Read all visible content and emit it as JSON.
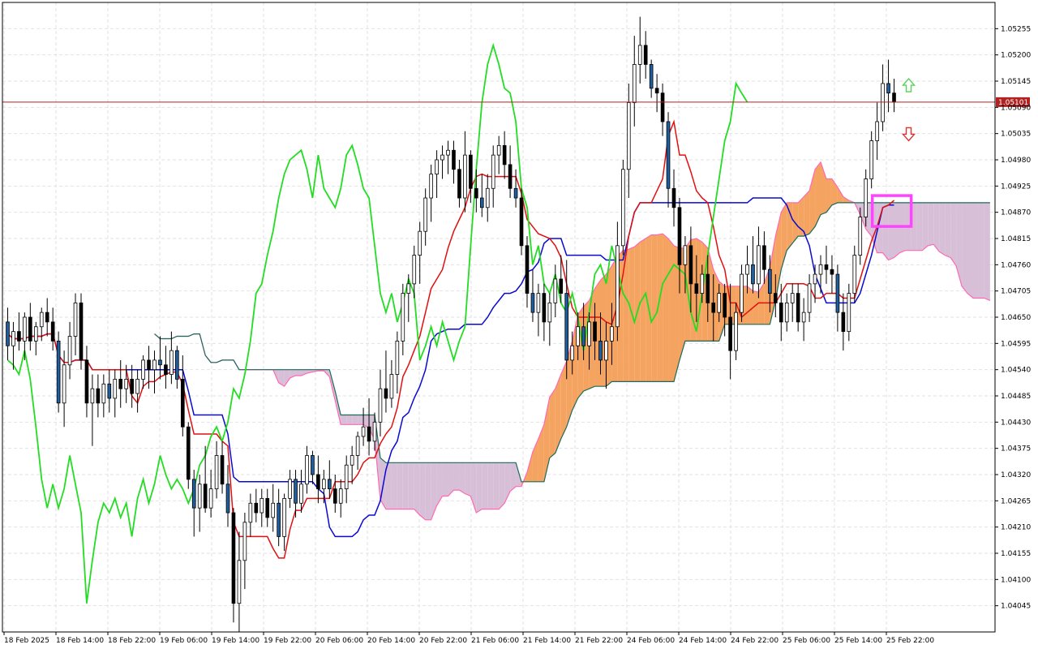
{
  "chart_data": {
    "type": "candlestick",
    "title": "",
    "y_axis": {
      "range": [
        1.0399,
        1.0531
      ],
      "ticks": [
        "1.05255",
        "1.05200",
        "1.05145",
        "1.05090",
        "1.05035",
        "1.04980",
        "1.04925",
        "1.04870",
        "1.04815",
        "1.04760",
        "1.04705",
        "1.04650",
        "1.04595",
        "1.04540",
        "1.04485",
        "1.04430",
        "1.04375",
        "1.04320",
        "1.04265",
        "1.04210",
        "1.04155",
        "1.04100",
        "1.04045"
      ]
    },
    "x_axis": {
      "ticks": [
        "18 Feb 2025",
        "18 Feb 14:00",
        "18 Feb 22:00",
        "19 Feb 06:00",
        "19 Feb 14:00",
        "19 Feb 22:00",
        "20 Feb 06:00",
        "20 Feb 14:00",
        "20 Feb 22:00",
        "21 Feb 06:00",
        "21 Feb 14:00",
        "21 Feb 22:00",
        "24 Feb 06:00",
        "24 Feb 14:00",
        "24 Feb 22:00",
        "25 Feb 06:00",
        "25 Feb 14:00",
        "25 Feb 22:00"
      ]
    },
    "current_price": "1.05101",
    "grid": true,
    "colors": {
      "bull_candle": "#ffffff",
      "bear_candle": "#000000",
      "alt_candle": "#1f5f9f",
      "tenkan": "#e01010",
      "kijun": "#0a0ad0",
      "chikou": "#22dd22",
      "cloud_bull": "#f4a460",
      "cloud_bear": "#d8bfd8",
      "span_line_teal": "#1a6b5a",
      "span_line_pink": "#ff69b4",
      "price_line": "#b22222",
      "highlight_box": "#ff44ff",
      "arrow_up": "#5ad05a",
      "arrow_down": "#e03030"
    },
    "candles": [
      [
        1.0464,
        1.0467,
        1.0456,
        1.0459
      ],
      [
        1.0459,
        1.0464,
        1.0454,
        1.0462
      ],
      [
        1.0462,
        1.0466,
        1.0458,
        1.046
      ],
      [
        1.046,
        1.0466,
        1.0456,
        1.0465
      ],
      [
        1.0465,
        1.0468,
        1.0458,
        1.046
      ],
      [
        1.046,
        1.0464,
        1.0457,
        1.0463
      ],
      [
        1.0463,
        1.0467,
        1.046,
        1.0466
      ],
      [
        1.0466,
        1.0469,
        1.0461,
        1.0464
      ],
      [
        1.0464,
        1.0467,
        1.0458,
        1.046
      ],
      [
        1.046,
        1.0462,
        1.0445,
        1.0447
      ],
      [
        1.0447,
        1.0458,
        1.0442,
        1.0455
      ],
      [
        1.0455,
        1.0464,
        1.0452,
        1.0461
      ],
      [
        1.0461,
        1.047,
        1.0457,
        1.0468
      ],
      [
        1.0468,
        1.047,
        1.0454,
        1.0456
      ],
      [
        1.0456,
        1.0459,
        1.0444,
        1.0447
      ],
      [
        1.0447,
        1.0453,
        1.0438,
        1.045
      ],
      [
        1.045,
        1.0453,
        1.0444,
        1.0447
      ],
      [
        1.0447,
        1.0453,
        1.0444,
        1.0451
      ],
      [
        1.0451,
        1.0454,
        1.0445,
        1.0448
      ],
      [
        1.0448,
        1.0454,
        1.0444,
        1.0452
      ],
      [
        1.0452,
        1.0456,
        1.0446,
        1.045
      ],
      [
        1.045,
        1.0455,
        1.0447,
        1.0452
      ],
      [
        1.0452,
        1.0455,
        1.0446,
        1.0449
      ],
      [
        1.0449,
        1.0454,
        1.0445,
        1.0452
      ],
      [
        1.0452,
        1.0457,
        1.045,
        1.0456
      ],
      [
        1.0456,
        1.0459,
        1.045,
        1.0454
      ],
      [
        1.0454,
        1.0458,
        1.0449,
        1.0456
      ],
      [
        1.0456,
        1.0461,
        1.0452,
        1.0455
      ],
      [
        1.0455,
        1.0459,
        1.045,
        1.0453
      ],
      [
        1.0453,
        1.0462,
        1.0451,
        1.0458
      ],
      [
        1.0458,
        1.0459,
        1.045,
        1.0452
      ],
      [
        1.0452,
        1.0457,
        1.044,
        1.0442
      ],
      [
        1.0442,
        1.0443,
        1.0429,
        1.0431
      ],
      [
        1.0431,
        1.0433,
        1.0419,
        1.0425
      ],
      [
        1.0425,
        1.0432,
        1.042,
        1.043
      ],
      [
        1.043,
        1.0438,
        1.0424,
        1.0425
      ],
      [
        1.0425,
        1.0433,
        1.0423,
        1.0429
      ],
      [
        1.0429,
        1.0439,
        1.0427,
        1.0436
      ],
      [
        1.0436,
        1.0439,
        1.0428,
        1.043
      ],
      [
        1.043,
        1.0434,
        1.0421,
        1.0424
      ],
      [
        1.0424,
        1.0425,
        1.0401,
        1.0405
      ],
      [
        1.0405,
        1.042,
        1.0399,
        1.0414
      ],
      [
        1.0414,
        1.0424,
        1.0408,
        1.0422
      ],
      [
        1.0422,
        1.0428,
        1.0419,
        1.0426
      ],
      [
        1.0426,
        1.0429,
        1.0422,
        1.0424
      ],
      [
        1.0424,
        1.0429,
        1.0421,
        1.0427
      ],
      [
        1.0427,
        1.0429,
        1.0421,
        1.0423
      ],
      [
        1.0423,
        1.043,
        1.042,
        1.0426
      ],
      [
        1.0426,
        1.0429,
        1.0417,
        1.0419
      ],
      [
        1.0419,
        1.0428,
        1.0416,
        1.0427
      ],
      [
        1.0427,
        1.0433,
        1.0425,
        1.0431
      ],
      [
        1.0431,
        1.0433,
        1.0423,
        1.0426
      ],
      [
        1.0426,
        1.0433,
        1.0424,
        1.043
      ],
      [
        1.043,
        1.0438,
        1.0428,
        1.0436
      ],
      [
        1.0436,
        1.0437,
        1.043,
        1.0432
      ],
      [
        1.0432,
        1.0436,
        1.0426,
        1.0429
      ],
      [
        1.0429,
        1.0433,
        1.0426,
        1.0431
      ],
      [
        1.0431,
        1.0435,
        1.0427,
        1.0429
      ],
      [
        1.0429,
        1.0432,
        1.0424,
        1.0426
      ],
      [
        1.0426,
        1.0431,
        1.0423,
        1.0429
      ],
      [
        1.0429,
        1.0436,
        1.0426,
        1.0434
      ],
      [
        1.0434,
        1.0438,
        1.043,
        1.0436
      ],
      [
        1.0436,
        1.0441,
        1.0433,
        1.044
      ],
      [
        1.044,
        1.0446,
        1.0438,
        1.0442
      ],
      [
        1.0442,
        1.0448,
        1.0436,
        1.0439
      ],
      [
        1.0439,
        1.0445,
        1.0437,
        1.0443
      ],
      [
        1.0443,
        1.0454,
        1.044,
        1.045
      ],
      [
        1.045,
        1.0458,
        1.0445,
        1.0448
      ],
      [
        1.0448,
        1.0456,
        1.0446,
        1.0453
      ],
      [
        1.0453,
        1.0462,
        1.0449,
        1.046
      ],
      [
        1.046,
        1.0472,
        1.0457,
        1.047
      ],
      [
        1.047,
        1.0474,
        1.0464,
        1.0472
      ],
      [
        1.0472,
        1.048,
        1.0469,
        1.0478
      ],
      [
        1.0478,
        1.0485,
        1.0472,
        1.0483
      ],
      [
        1.0483,
        1.0492,
        1.048,
        1.049
      ],
      [
        1.049,
        1.0497,
        1.0485,
        1.0495
      ],
      [
        1.0495,
        1.05,
        1.049,
        1.0498
      ],
      [
        1.0498,
        1.0501,
        1.0494,
        1.0499
      ],
      [
        1.0499,
        1.0502,
        1.0495,
        1.05
      ],
      [
        1.05,
        1.0502,
        1.0493,
        1.0496
      ],
      [
        1.0496,
        1.0498,
        1.0488,
        1.049
      ],
      [
        1.049,
        1.0504,
        1.0487,
        1.0499
      ],
      [
        1.0499,
        1.05,
        1.0489,
        1.0492
      ],
      [
        1.0492,
        1.0496,
        1.0487,
        1.049
      ],
      [
        1.049,
        1.0495,
        1.0486,
        1.0488
      ],
      [
        1.0488,
        1.0495,
        1.0485,
        1.0492
      ],
      [
        1.0492,
        1.0501,
        1.0488,
        1.0499
      ],
      [
        1.0499,
        1.0503,
        1.0495,
        1.0501
      ],
      [
        1.0501,
        1.0504,
        1.0494,
        1.0497
      ],
      [
        1.0497,
        1.0501,
        1.049,
        1.0492
      ],
      [
        1.0492,
        1.0496,
        1.0488,
        1.049
      ],
      [
        1.049,
        1.0492,
        1.0478,
        1.048
      ],
      [
        1.048,
        1.0482,
        1.0467,
        1.047
      ],
      [
        1.047,
        1.0475,
        1.0464,
        1.0466
      ],
      [
        1.0466,
        1.0472,
        1.0461,
        1.047
      ],
      [
        1.047,
        1.0472,
        1.046,
        1.0464
      ],
      [
        1.0464,
        1.047,
        1.0459,
        1.0468
      ],
      [
        1.0468,
        1.0476,
        1.0465,
        1.0473
      ],
      [
        1.0473,
        1.0478,
        1.0468,
        1.047
      ],
      [
        1.047,
        1.0477,
        1.0452,
        1.0456
      ],
      [
        1.0456,
        1.0462,
        1.0453,
        1.0459
      ],
      [
        1.0459,
        1.0466,
        1.0456,
        1.0463
      ],
      [
        1.0463,
        1.0468,
        1.0456,
        1.0459
      ],
      [
        1.0459,
        1.0466,
        1.0454,
        1.0464
      ],
      [
        1.0464,
        1.0468,
        1.0456,
        1.046
      ],
      [
        1.046,
        1.0466,
        1.0453,
        1.0456
      ],
      [
        1.0456,
        1.0464,
        1.045,
        1.046
      ],
      [
        1.046,
        1.0468,
        1.0455,
        1.0463
      ],
      [
        1.0463,
        1.0485,
        1.046,
        1.048
      ],
      [
        1.048,
        1.0498,
        1.0478,
        1.0496
      ],
      [
        1.0496,
        1.0514,
        1.049,
        1.051
      ],
      [
        1.051,
        1.0524,
        1.0505,
        1.0518
      ],
      [
        1.0518,
        1.0528,
        1.0514,
        1.0522
      ],
      [
        1.0522,
        1.0525,
        1.0515,
        1.0518
      ],
      [
        1.0518,
        1.0519,
        1.0511,
        1.0513
      ],
      [
        1.0513,
        1.0516,
        1.0508,
        1.0512
      ],
      [
        1.0512,
        1.0514,
        1.0503,
        1.0506
      ],
      [
        1.0506,
        1.0508,
        1.0488,
        1.0492
      ],
      [
        1.0492,
        1.0496,
        1.0484,
        1.0488
      ],
      [
        1.0488,
        1.049,
        1.047,
        1.0476
      ],
      [
        1.0476,
        1.0482,
        1.047,
        1.048
      ],
      [
        1.048,
        1.0484,
        1.0466,
        1.0472
      ],
      [
        1.0472,
        1.0478,
        1.0464,
        1.047
      ],
      [
        1.047,
        1.0476,
        1.0468,
        1.0474
      ],
      [
        1.0474,
        1.0478,
        1.0464,
        1.0468
      ],
      [
        1.0468,
        1.0474,
        1.046,
        1.0466
      ],
      [
        1.0466,
        1.0472,
        1.0464,
        1.047
      ],
      [
        1.047,
        1.0472,
        1.0461,
        1.0465
      ],
      [
        1.0465,
        1.0472,
        1.0452,
        1.0458
      ],
      [
        1.0458,
        1.0468,
        1.0456,
        1.0466
      ],
      [
        1.0466,
        1.0476,
        1.0464,
        1.0474
      ],
      [
        1.0474,
        1.048,
        1.047,
        1.0476
      ],
      [
        1.0476,
        1.0482,
        1.047,
        1.0472
      ],
      [
        1.0472,
        1.0484,
        1.0469,
        1.048
      ],
      [
        1.048,
        1.0483,
        1.0472,
        1.0475
      ],
      [
        1.0475,
        1.0478,
        1.0466,
        1.047
      ],
      [
        1.047,
        1.0474,
        1.0465,
        1.0468
      ],
      [
        1.0468,
        1.0472,
        1.046,
        1.0464
      ],
      [
        1.0464,
        1.047,
        1.0462,
        1.0468
      ],
      [
        1.0468,
        1.0472,
        1.0464,
        1.047
      ],
      [
        1.047,
        1.0472,
        1.0462,
        1.0464
      ],
      [
        1.0464,
        1.0469,
        1.046,
        1.0466
      ],
      [
        1.0466,
        1.0474,
        1.0464,
        1.0472
      ],
      [
        1.0472,
        1.0476,
        1.0468,
        1.0474
      ],
      [
        1.0474,
        1.0478,
        1.047,
        1.0476
      ],
      [
        1.0476,
        1.048,
        1.0472,
        1.0475
      ],
      [
        1.0475,
        1.0478,
        1.047,
        1.0474
      ],
      [
        1.0474,
        1.0476,
        1.0462,
        1.0466
      ],
      [
        1.0466,
        1.047,
        1.0458,
        1.0462
      ],
      [
        1.0462,
        1.0472,
        1.046,
        1.047
      ],
      [
        1.047,
        1.048,
        1.0468,
        1.0478
      ],
      [
        1.0478,
        1.0488,
        1.0476,
        1.0486
      ],
      [
        1.0486,
        1.0496,
        1.0484,
        1.0494
      ],
      [
        1.0494,
        1.0504,
        1.0492,
        1.0502
      ],
      [
        1.0502,
        1.051,
        1.0498,
        1.0506
      ],
      [
        1.0506,
        1.0518,
        1.0504,
        1.0514
      ],
      [
        1.0514,
        1.0519,
        1.0508,
        1.0512
      ],
      [
        1.0512,
        1.0515,
        1.0508,
        1.05101
      ]
    ]
  },
  "ui": {
    "arrow_up_icon": "arrow-up-outline",
    "arrow_down_icon": "arrow-down-outline"
  }
}
